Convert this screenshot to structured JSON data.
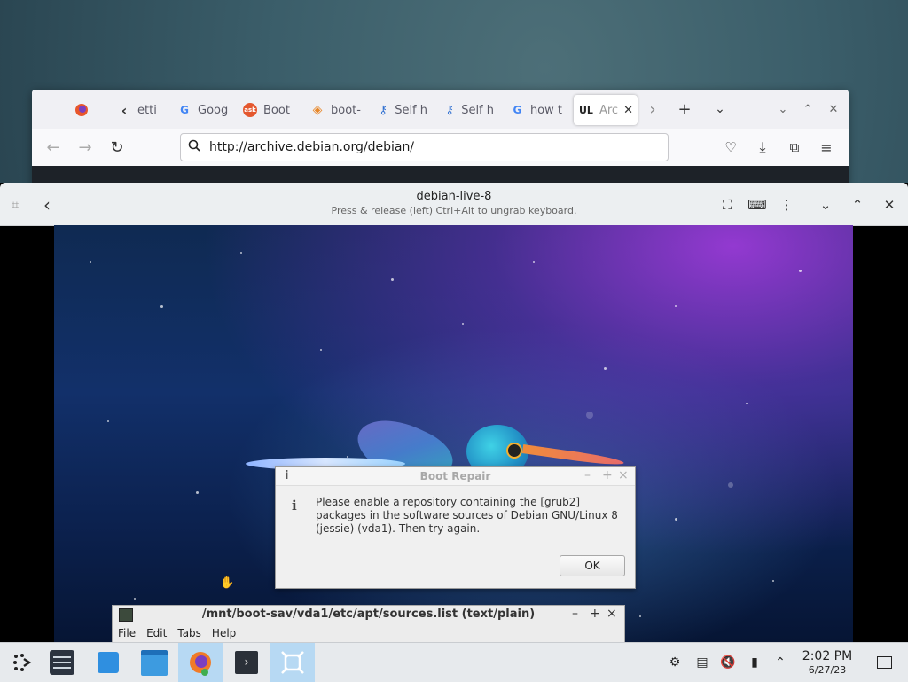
{
  "firefox": {
    "tabs": [
      {
        "label": "",
        "icon": "firefox-icon"
      },
      {
        "label": "etti",
        "icon": "back-arrow-icon"
      },
      {
        "label": "Goog",
        "icon": "google-icon"
      },
      {
        "label": "Boot",
        "icon": "askubuntu-icon"
      },
      {
        "label": "boot-",
        "icon": "diamond-icon"
      },
      {
        "label": "Self h",
        "icon": "key-icon"
      },
      {
        "label": "Self h",
        "icon": "key-icon"
      },
      {
        "label": "how t",
        "icon": "google-icon"
      },
      {
        "label": "Arc",
        "icon": "ul-icon"
      }
    ],
    "url": "http://archive.debian.org/debian/"
  },
  "vm": {
    "title": "debian-live-8",
    "subtitle": "Press & release (left) Ctrl+Alt to ungrab keyboard."
  },
  "dialog": {
    "icon_letter": "i",
    "title": "Boot Repair",
    "message": "Please enable a repository containing the [grub2] packages in the software sources of Debian GNU/Linux 8 (jessie) (vda1). Then try again.",
    "ok_label": "OK",
    "minimize": "–",
    "maximize": "+",
    "close": "×"
  },
  "editor": {
    "title": "/mnt/boot-sav/vda1/etc/apt/sources.list (text/plain)",
    "menu": [
      "File",
      "Edit",
      "Tabs",
      "Help"
    ],
    "minimize": "–",
    "maximize": "+",
    "close": "×"
  },
  "taskbar": {
    "time": "2:02 PM",
    "date": "6/27/23"
  }
}
